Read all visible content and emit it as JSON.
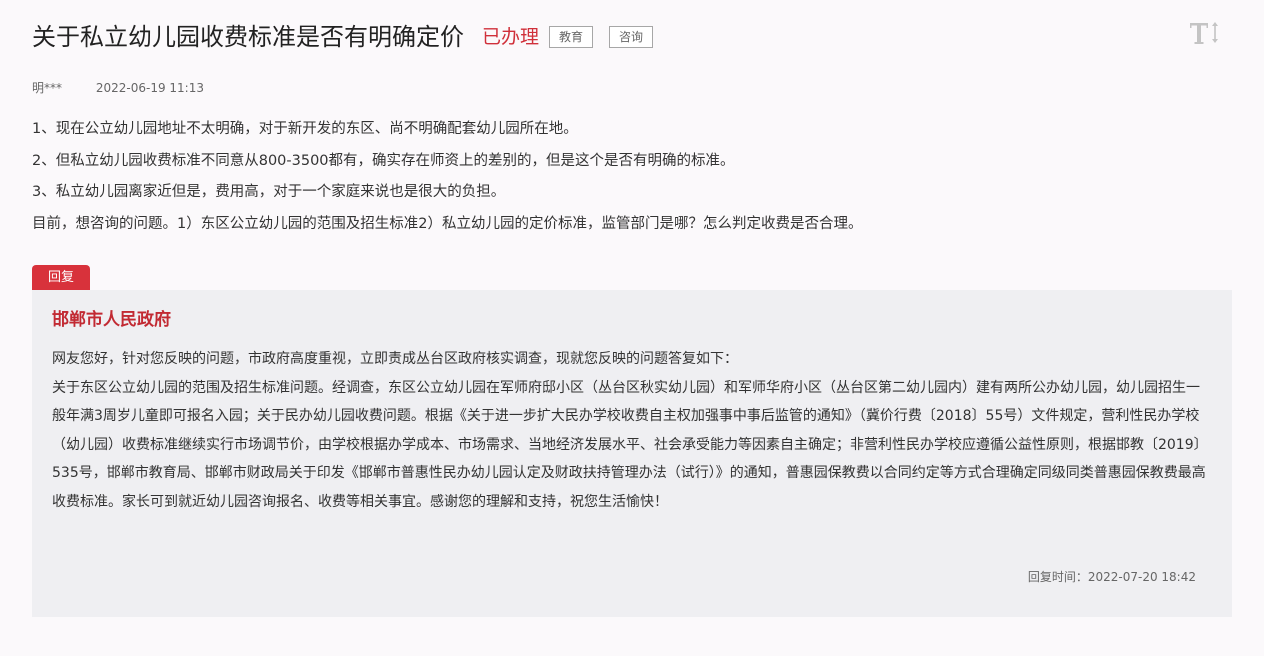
{
  "header": {
    "title": "关于私立幼儿园收费标准是否有明确定价",
    "status": "已办理",
    "tags": [
      "教育",
      "咨询"
    ],
    "font_toggle_icon": "text-size-icon"
  },
  "meta": {
    "author": "明***",
    "date": "2022-06-19 11:13"
  },
  "question": {
    "lines": [
      "1、现在公立幼儿园地址不太明确，对于新开发的东区、尚不明确配套幼儿园所在地。",
      "2、但私立幼儿园收费标准不同意从800-3500都有，确实存在师资上的差别的，但是这个是否有明确的标准。",
      "3、私立幼儿园离家近但是，费用高，对于一个家庭来说也是很大的负担。",
      "目前，想咨询的问题。1）东区公立幼儿园的范围及招生标准2）私立幼儿园的定价标准，监管部门是哪？怎么判定收费是否合理。"
    ]
  },
  "reply": {
    "tag_label": "回复",
    "org": "邯郸市人民政府",
    "paragraphs": [
      "网友您好，针对您反映的问题，市政府高度重视，立即责成丛台区政府核实调查，现就您反映的问题答复如下：",
      "关于东区公立幼儿园的范围及招生标准问题。经调查，东区公立幼儿园在军师府邸小区（丛台区秋实幼儿园）和军师华府小区（丛台区第二幼儿园内）建有两所公办幼儿园，幼儿园招生一般年满3周岁儿童即可报名入园；关于民办幼儿园收费问题。根据《关于进一步扩大民办学校收费自主权加强事中事后监管的通知》（冀价行费〔2018〕55号）文件规定，营利性民办学校（幼儿园）收费标准继续实行市场调节价，由学校根据办学成本、市场需求、当地经济发展水平、社会承受能力等因素自主确定；非营利性民办学校应遵循公益性原则，根据邯教〔2019〕535号，邯郸市教育局、邯郸市财政局关于印发《邯郸市普惠性民办幼儿园认定及财政扶持管理办法（试行）》的通知，普惠园保教费以合同约定等方式合理确定同级同类普惠园保教费最高收费标准。家长可到就近幼儿园咨询报名、收费等相关事宜。感谢您的理解和支持，祝您生活愉快！"
    ],
    "time_label": "回复时间：",
    "time": "2022-07-20 18:42"
  },
  "colors": {
    "accent_red": "#d8323b",
    "org_red": "#c22a33",
    "reply_bg": "#efeff2",
    "page_bg": "#fbf9fb"
  }
}
